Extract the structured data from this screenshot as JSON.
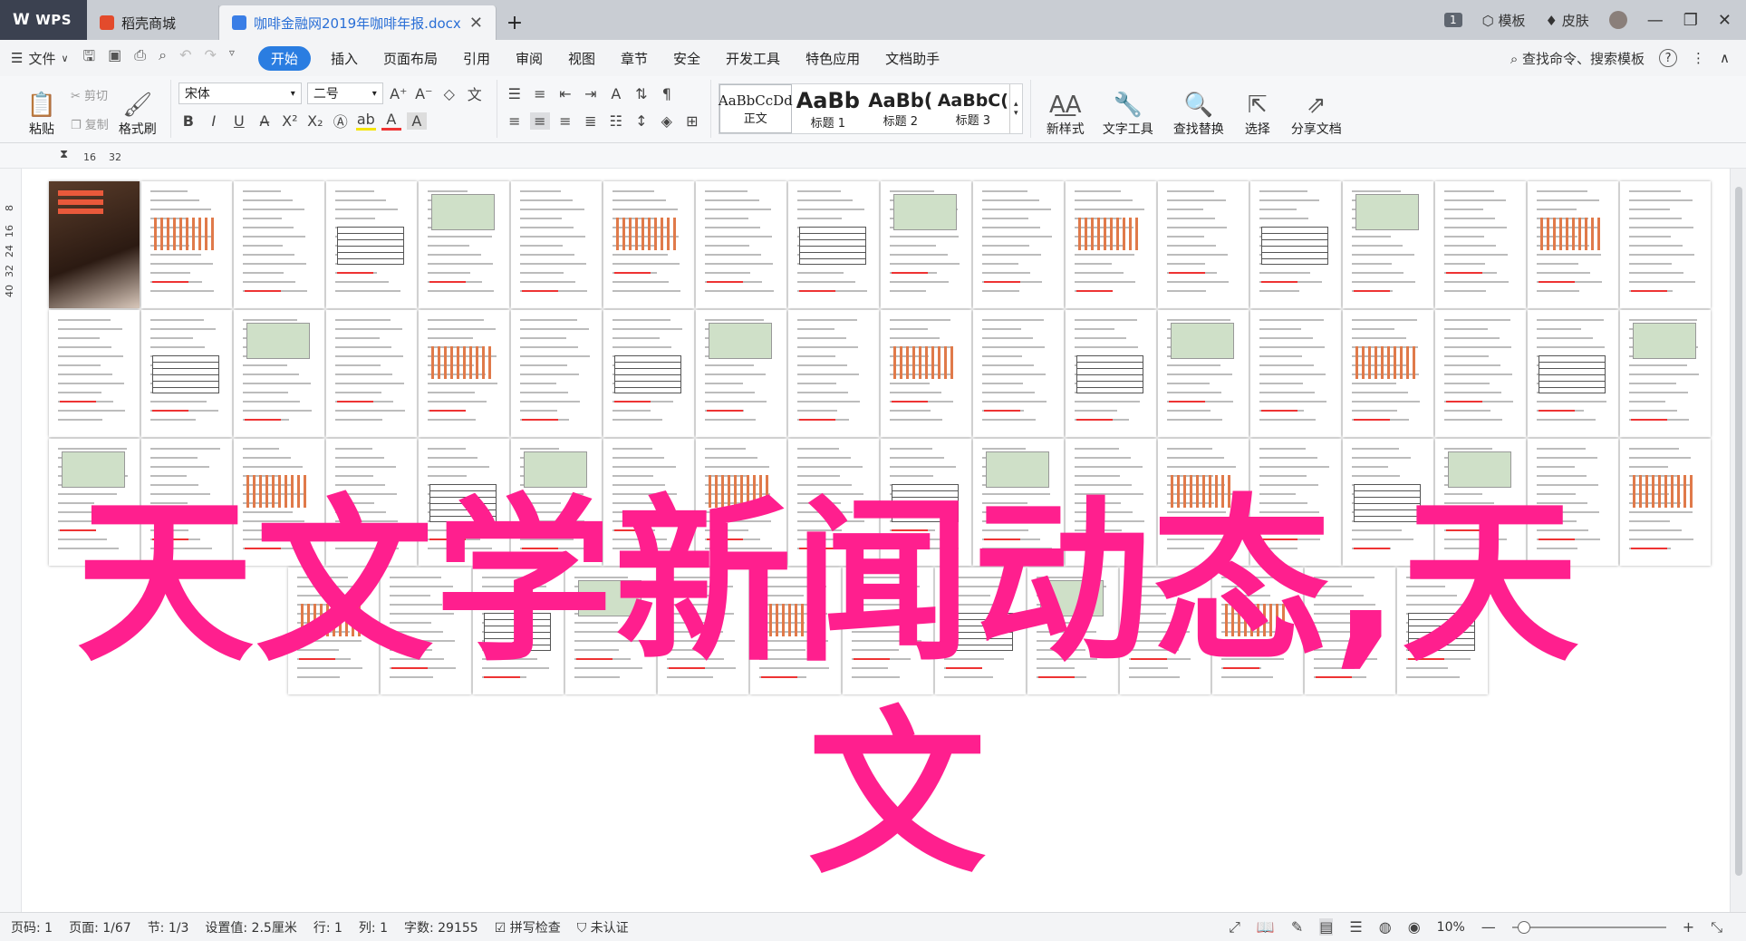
{
  "titlebar": {
    "wps_label": "WPS",
    "tab_shop": "稻壳商城",
    "tab_doc": "咖啡金融网2019年咖啡年报.docx",
    "add_tab": "+",
    "badge": "1",
    "template_label": "模板",
    "skin_label": "皮肤",
    "minimize": "—",
    "restore": "❐",
    "close": "✕"
  },
  "menubar": {
    "file": "文件",
    "items": [
      "开始",
      "插入",
      "页面布局",
      "引用",
      "审阅",
      "视图",
      "章节",
      "安全",
      "开发工具",
      "特色应用",
      "文档助手"
    ],
    "search": "查找命令、搜索模板",
    "help": "?"
  },
  "ribbon": {
    "paste": "粘贴",
    "cut": "剪切",
    "copy": "复制",
    "format_painter": "格式刷",
    "font_name": "宋体",
    "font_size": "二号",
    "styles": [
      {
        "sample": "AaBbCcDd",
        "label": "正文"
      },
      {
        "sample": "AaBb",
        "label": "标题 1"
      },
      {
        "sample": "AaBb(",
        "label": "标题 2"
      },
      {
        "sample": "AaBbC(",
        "label": "标题 3"
      }
    ],
    "new_style": "新样式",
    "text_tools": "文字工具",
    "find_replace": "查找替换",
    "select": "选择",
    "share_doc": "分享文档"
  },
  "ruler": {
    "h_marks": [
      "16",
      "32"
    ],
    "v_marks": [
      "8",
      "16",
      "24",
      "32",
      "40"
    ]
  },
  "overlay": {
    "line1": "天文学新闻动态,天",
    "line2": "文"
  },
  "statusbar": {
    "page_num": "页码: 1",
    "page": "页面: 1/67",
    "section": "节: 1/3",
    "setting": "设置值: 2.5厘米",
    "row": "行: 1",
    "col": "列: 1",
    "words": "字数: 29155",
    "spell": "拼写检查",
    "cert": "未认证",
    "zoom": "10%"
  },
  "colors": {
    "accent": "#2a7de1",
    "overlay_text": "#ff1f8e",
    "titlebar": "#c9cdd3"
  }
}
